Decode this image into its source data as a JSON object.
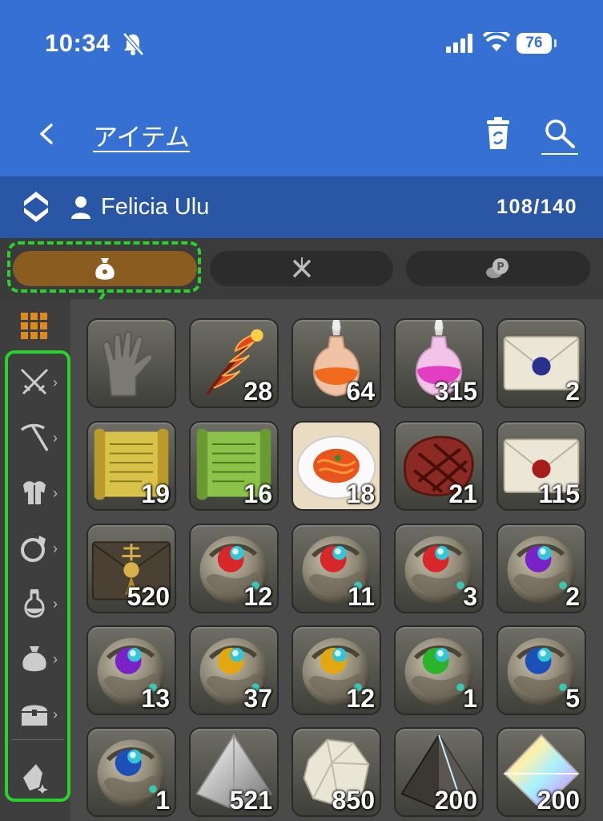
{
  "status_bar": {
    "time": "10:34",
    "battery": "76"
  },
  "header": {
    "title": "アイテム"
  },
  "character": {
    "name": "Felicia Ulu",
    "capacity": "108/140"
  },
  "tabs": [
    {
      "icon": "bag-icon",
      "active": true
    },
    {
      "icon": "crossed-tools-icon",
      "active": false
    },
    {
      "icon": "coins-icon",
      "active": false
    }
  ],
  "sidebar": {
    "items": [
      "grid-icon",
      "swords-icon",
      "pickaxe-icon",
      "armor-icon",
      "ring-icon",
      "potion-icon",
      "bag-icon",
      "chest-icon",
      "crystal-icon"
    ]
  },
  "items": [
    {
      "icon": "gloves",
      "qty": ""
    },
    {
      "icon": "phoenix-feather",
      "qty": "28"
    },
    {
      "icon": "orange-potion",
      "qty": "64"
    },
    {
      "icon": "pink-potion",
      "qty": "315"
    },
    {
      "icon": "blue-sealed-letter",
      "qty": "2"
    },
    {
      "icon": "yellow-scroll",
      "qty": "19"
    },
    {
      "icon": "green-scroll",
      "qty": "16"
    },
    {
      "icon": "pasta-plate",
      "qty": "18"
    },
    {
      "icon": "steak",
      "qty": "21"
    },
    {
      "icon": "red-sealed-letter",
      "qty": "115"
    },
    {
      "icon": "gold-envelope",
      "qty": "520"
    },
    {
      "icon": "red-materia",
      "qty": "12"
    },
    {
      "icon": "red-materia",
      "qty": "11"
    },
    {
      "icon": "red-materia",
      "qty": "3"
    },
    {
      "icon": "purple-materia",
      "qty": "2"
    },
    {
      "icon": "purple-materia",
      "qty": "13"
    },
    {
      "icon": "yellow-materia",
      "qty": "37"
    },
    {
      "icon": "yellow-materia",
      "qty": "12"
    },
    {
      "icon": "green-materia",
      "qty": "1"
    },
    {
      "icon": "blue-materia",
      "qty": "5"
    },
    {
      "icon": "blue-materia",
      "qty": "1"
    },
    {
      "icon": "clear-prism",
      "qty": "521"
    },
    {
      "icon": "white-ore",
      "qty": "850"
    },
    {
      "icon": "dark-prism",
      "qty": "200"
    },
    {
      "icon": "rainbow-prism",
      "qty": "200"
    }
  ],
  "colors": {
    "header_blue": "#3770d3",
    "charbar_blue": "#2a56a6",
    "tab_active": "#8a5c20",
    "highlight_green": "#27d52a"
  }
}
